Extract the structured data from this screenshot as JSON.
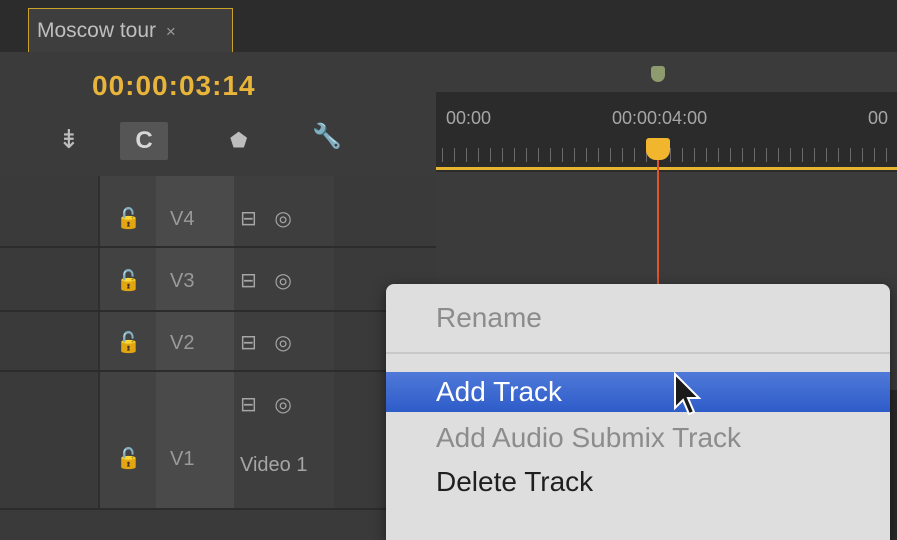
{
  "tab": {
    "title": "Moscow tour",
    "close_glyph": "×"
  },
  "timecode": "00:00:03:14",
  "tools": [
    {
      "name": "insert-track-icon",
      "glyph": "⇟"
    },
    {
      "name": "snap-icon",
      "glyph": "C"
    },
    {
      "name": "marker-icon",
      "glyph": "⬟"
    },
    {
      "name": "wrench-icon",
      "glyph": "🔧"
    }
  ],
  "ruler": {
    "labels": [
      "00:00",
      "00:00:04:00",
      "00"
    ]
  },
  "tracks": [
    {
      "lock_glyph": "🔓",
      "name": "V4",
      "icons": "⊟ ◎"
    },
    {
      "lock_glyph": "🔓",
      "name": "V3",
      "icons": "⊟ ◎"
    },
    {
      "lock_glyph": "🔓",
      "name": "V2",
      "icons": "⊟ ◎"
    },
    {
      "lock_glyph": "🔓",
      "name": "V1",
      "icons": "⊟ ◎",
      "label": "Video 1"
    }
  ],
  "context_menu": {
    "items": [
      {
        "label": "Rename",
        "state": "disabled"
      },
      {
        "label": "Add Track",
        "state": "active"
      },
      {
        "label": "Add Audio Submix Track",
        "state": "disabled"
      },
      {
        "label": "Delete Track",
        "state": "enabled"
      }
    ]
  },
  "colors": {
    "accent": "#e8b43a",
    "playhead": "#e0552c",
    "menu_highlight": "#2e5cc8"
  }
}
